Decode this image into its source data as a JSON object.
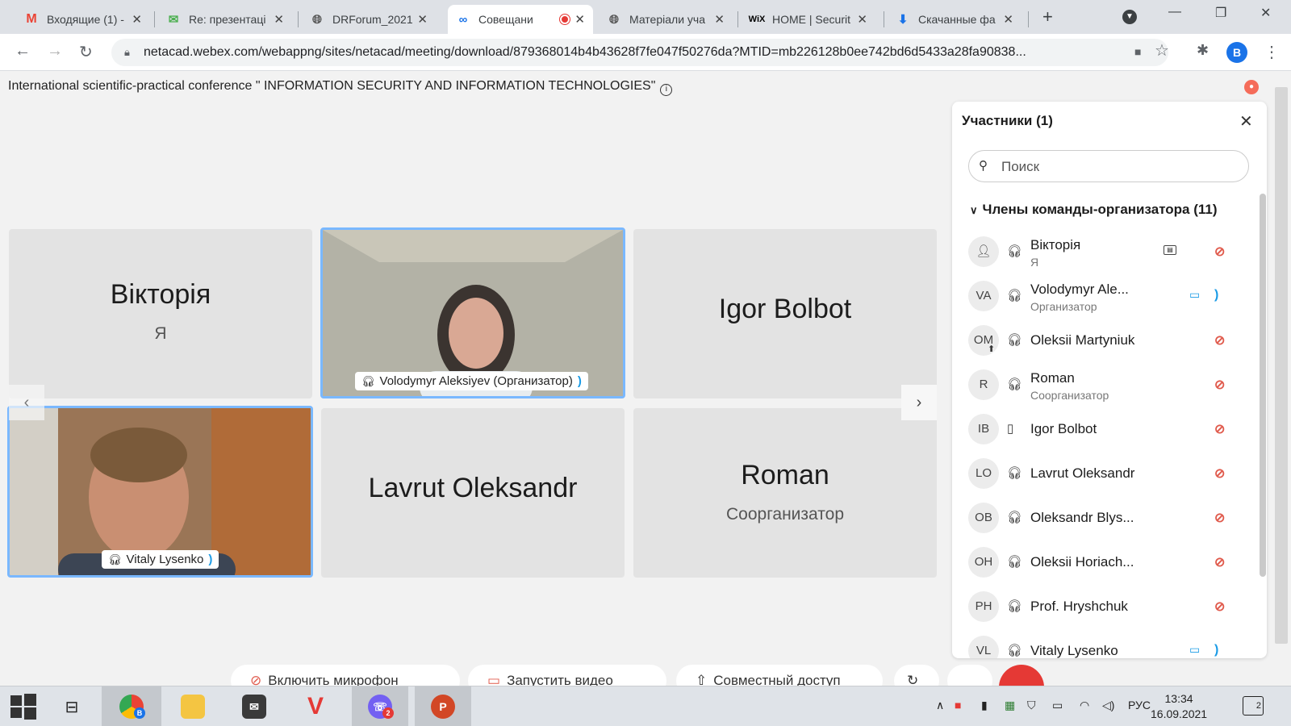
{
  "browser": {
    "tabs": [
      {
        "title": "Входящие (1) -",
        "favicon": "gmail-icon",
        "color": "#ea4335"
      },
      {
        "title": "Re: презентаці",
        "favicon": "mail-icon",
        "color": "#4caf50"
      },
      {
        "title": "DRForum_2021",
        "favicon": "globe-icon",
        "color": "#555555"
      },
      {
        "title": "Совещани",
        "favicon": "webex-icon",
        "color": "#1a73e8"
      },
      {
        "title": "Матеріали уча",
        "favicon": "globe-icon",
        "color": "#555555"
      },
      {
        "title": "HOME | Securit",
        "favicon": "wix-icon",
        "color": "#000000"
      },
      {
        "title": "Скачанные фа",
        "favicon": "download-icon",
        "color": "#1a73e8"
      }
    ],
    "url": "netacad.webex.com/webappng/sites/netacad/meeting/download/879368014b4b43628f7fe047f50276da?MTID=mb226128b0ee742bd6d5433a28fa90838...",
    "profile_initial": "B"
  },
  "meeting": {
    "title": "International scientific-practical conference \" INFORMATION SECURITY AND INFORMATION TECHNOLOGIES\"",
    "tiles": [
      {
        "name": "Вікторія",
        "sub": "Я"
      },
      {
        "label": "Volodymyr Aleksiyev (Организатор)"
      },
      {
        "name": "Igor Bolbot"
      },
      {
        "label": "Vitaly Lysenko"
      },
      {
        "name": "Lavrut Oleksandr"
      },
      {
        "name": "Roman",
        "sub": "Соорганизатор"
      }
    ],
    "controls": {
      "mic": "Включить микрофон",
      "video": "Запустить видео",
      "share": "Совместный доступ"
    }
  },
  "participants": {
    "title": "Участники (1)",
    "search_placeholder": "Поиск",
    "section_title": "Члены команды-организатора (11)",
    "list": [
      {
        "initials": "",
        "name": "Вікторія",
        "role": "Я"
      },
      {
        "initials": "VA",
        "name": "Volodymyr Ale...",
        "role": "Организатор"
      },
      {
        "initials": "OM",
        "name": "Oleksii Martyniuk",
        "role": ""
      },
      {
        "initials": "R",
        "name": "Roman",
        "role": "Соорганизатор"
      },
      {
        "initials": "IB",
        "name": "Igor Bolbot",
        "role": ""
      },
      {
        "initials": "LO",
        "name": "Lavrut Oleksandr",
        "role": ""
      },
      {
        "initials": "OB",
        "name": "Oleksandr Blys...",
        "role": ""
      },
      {
        "initials": "OH",
        "name": "Oleksii Horiach...",
        "role": ""
      },
      {
        "initials": "PH",
        "name": "Prof. Hryshchuk",
        "role": ""
      },
      {
        "initials": "VL",
        "name": "Vitaly Lysenko",
        "role": ""
      }
    ]
  },
  "taskbar": {
    "lang": "РУС",
    "time": "13:34",
    "date": "16.09.2021",
    "viber_badge": "2",
    "chrome_profile": "B",
    "notifications": "2"
  }
}
